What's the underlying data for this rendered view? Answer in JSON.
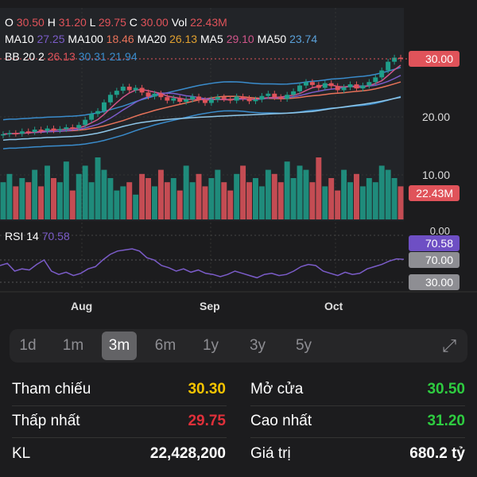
{
  "ohlc": {
    "o_label": "O",
    "o": "30.50",
    "h_label": "H",
    "h": "31.20",
    "l_label": "L",
    "l": "29.75",
    "c_label": "C",
    "c": "30.00",
    "vol_label": "Vol",
    "vol": "22.43M"
  },
  "ma": [
    {
      "label": "MA10",
      "value": "27.25",
      "color": "#7b5cc9"
    },
    {
      "label": "MA100",
      "value": "18.46",
      "color": "#e8735a"
    },
    {
      "label": "MA20",
      "value": "26.13",
      "color": "#e0a030"
    },
    {
      "label": "MA5",
      "value": "29.10",
      "color": "#d0558a"
    },
    {
      "label": "MA50",
      "value": "23.74",
      "color": "#5aa0d8"
    }
  ],
  "bb": {
    "label": "BB 20 2",
    "mid": "26.13",
    "upper": "30.31",
    "lower": "21.94"
  },
  "price_axis": [
    "30.00",
    "20.00",
    "10.00",
    "0.00"
  ],
  "last_price_tag": "30.00",
  "volume_tag": "22.43M",
  "rsi": {
    "label": "RSI 14",
    "value": "70.58",
    "levels": [
      "70.00",
      "30.00"
    ]
  },
  "months": [
    "Aug",
    "Sep",
    "Oct"
  ],
  "ranges": [
    "1d",
    "1m",
    "3m",
    "6m",
    "1y",
    "3y",
    "5y"
  ],
  "active_range": "3m",
  "stats": {
    "ref_label": "Tham chiếu",
    "ref": "30.30",
    "open_label": "Mở cửa",
    "open": "30.50",
    "low_label": "Thấp nhất",
    "low": "29.75",
    "high_label": "Cao nhất",
    "high": "31.20",
    "vol_label": "KL",
    "vol": "22,428,200",
    "value_label": "Giá trị",
    "value": "680.2 tỷ"
  },
  "colors": {
    "up": "#1f9e8a",
    "down": "#e0535a",
    "rsi": "#7b5cc9"
  },
  "chart_data": {
    "type": "candlestick",
    "closes": [
      17,
      17.2,
      17.1,
      17.5,
      17.4,
      17.8,
      17.6,
      18,
      17.7,
      17.9,
      18.2,
      18.1,
      18.6,
      19.5,
      20.5,
      21,
      22.5,
      23.8,
      24.5,
      25.2,
      24.6,
      25,
      24.2,
      23.5,
      24,
      23.4,
      22.8,
      23.2,
      22.6,
      23,
      23.5,
      22.9,
      22.4,
      23,
      23.4,
      23.1,
      22.8,
      23.5,
      23.2,
      22.7,
      23,
      23.6,
      24,
      23.4,
      23.1,
      23.8,
      24.4,
      25.4,
      26,
      25.5,
      25,
      25.8,
      25.3,
      24.6,
      25.1,
      25.6,
      24.9,
      25.4,
      26,
      26.8,
      28,
      29.5,
      30.2,
      30
    ],
    "volumes": [
      9,
      11,
      8,
      10,
      9,
      12,
      8,
      13,
      10,
      9,
      14,
      7,
      11,
      13,
      9,
      15,
      12,
      10,
      7,
      8,
      9,
      6,
      11,
      10,
      8,
      12,
      9,
      10,
      7,
      13,
      9,
      11,
      8,
      10,
      12,
      9,
      7,
      11,
      13,
      9,
      10,
      8,
      12,
      11,
      9,
      14,
      10,
      13,
      12,
      9,
      15,
      8,
      10,
      7,
      12,
      9,
      11,
      8,
      10,
      9,
      13,
      12,
      10,
      8
    ],
    "rsi": [
      65,
      67,
      60,
      62,
      61,
      66,
      70,
      60,
      57,
      59,
      56,
      58,
      62,
      64,
      70,
      75,
      78,
      79,
      80,
      78,
      72,
      70,
      65,
      63,
      60,
      62,
      59,
      61,
      58,
      57,
      55,
      57,
      60,
      58,
      56,
      54,
      57,
      58,
      56,
      57,
      60,
      64,
      66,
      65,
      60,
      58,
      56,
      59,
      57,
      58,
      62,
      64,
      66,
      69,
      71,
      70.58
    ]
  }
}
